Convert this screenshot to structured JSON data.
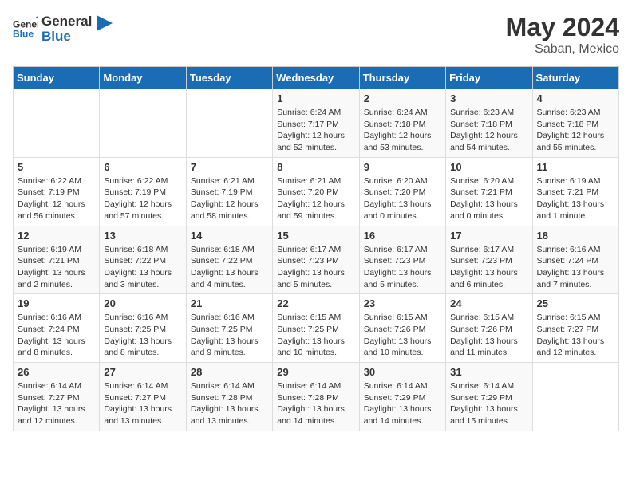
{
  "header": {
    "logo_general": "General",
    "logo_blue": "Blue",
    "month_year": "May 2024",
    "location": "Saban, Mexico"
  },
  "days_of_week": [
    "Sunday",
    "Monday",
    "Tuesday",
    "Wednesday",
    "Thursday",
    "Friday",
    "Saturday"
  ],
  "weeks": [
    [
      {
        "day": "",
        "info": ""
      },
      {
        "day": "",
        "info": ""
      },
      {
        "day": "",
        "info": ""
      },
      {
        "day": "1",
        "info": "Sunrise: 6:24 AM\nSunset: 7:17 PM\nDaylight: 12 hours and 52 minutes."
      },
      {
        "day": "2",
        "info": "Sunrise: 6:24 AM\nSunset: 7:18 PM\nDaylight: 12 hours and 53 minutes."
      },
      {
        "day": "3",
        "info": "Sunrise: 6:23 AM\nSunset: 7:18 PM\nDaylight: 12 hours and 54 minutes."
      },
      {
        "day": "4",
        "info": "Sunrise: 6:23 AM\nSunset: 7:18 PM\nDaylight: 12 hours and 55 minutes."
      }
    ],
    [
      {
        "day": "5",
        "info": "Sunrise: 6:22 AM\nSunset: 7:19 PM\nDaylight: 12 hours and 56 minutes."
      },
      {
        "day": "6",
        "info": "Sunrise: 6:22 AM\nSunset: 7:19 PM\nDaylight: 12 hours and 57 minutes."
      },
      {
        "day": "7",
        "info": "Sunrise: 6:21 AM\nSunset: 7:19 PM\nDaylight: 12 hours and 58 minutes."
      },
      {
        "day": "8",
        "info": "Sunrise: 6:21 AM\nSunset: 7:20 PM\nDaylight: 12 hours and 59 minutes."
      },
      {
        "day": "9",
        "info": "Sunrise: 6:20 AM\nSunset: 7:20 PM\nDaylight: 13 hours and 0 minutes."
      },
      {
        "day": "10",
        "info": "Sunrise: 6:20 AM\nSunset: 7:21 PM\nDaylight: 13 hours and 0 minutes."
      },
      {
        "day": "11",
        "info": "Sunrise: 6:19 AM\nSunset: 7:21 PM\nDaylight: 13 hours and 1 minute."
      }
    ],
    [
      {
        "day": "12",
        "info": "Sunrise: 6:19 AM\nSunset: 7:21 PM\nDaylight: 13 hours and 2 minutes."
      },
      {
        "day": "13",
        "info": "Sunrise: 6:18 AM\nSunset: 7:22 PM\nDaylight: 13 hours and 3 minutes."
      },
      {
        "day": "14",
        "info": "Sunrise: 6:18 AM\nSunset: 7:22 PM\nDaylight: 13 hours and 4 minutes."
      },
      {
        "day": "15",
        "info": "Sunrise: 6:17 AM\nSunset: 7:23 PM\nDaylight: 13 hours and 5 minutes."
      },
      {
        "day": "16",
        "info": "Sunrise: 6:17 AM\nSunset: 7:23 PM\nDaylight: 13 hours and 5 minutes."
      },
      {
        "day": "17",
        "info": "Sunrise: 6:17 AM\nSunset: 7:23 PM\nDaylight: 13 hours and 6 minutes."
      },
      {
        "day": "18",
        "info": "Sunrise: 6:16 AM\nSunset: 7:24 PM\nDaylight: 13 hours and 7 minutes."
      }
    ],
    [
      {
        "day": "19",
        "info": "Sunrise: 6:16 AM\nSunset: 7:24 PM\nDaylight: 13 hours and 8 minutes."
      },
      {
        "day": "20",
        "info": "Sunrise: 6:16 AM\nSunset: 7:25 PM\nDaylight: 13 hours and 8 minutes."
      },
      {
        "day": "21",
        "info": "Sunrise: 6:16 AM\nSunset: 7:25 PM\nDaylight: 13 hours and 9 minutes."
      },
      {
        "day": "22",
        "info": "Sunrise: 6:15 AM\nSunset: 7:25 PM\nDaylight: 13 hours and 10 minutes."
      },
      {
        "day": "23",
        "info": "Sunrise: 6:15 AM\nSunset: 7:26 PM\nDaylight: 13 hours and 10 minutes."
      },
      {
        "day": "24",
        "info": "Sunrise: 6:15 AM\nSunset: 7:26 PM\nDaylight: 13 hours and 11 minutes."
      },
      {
        "day": "25",
        "info": "Sunrise: 6:15 AM\nSunset: 7:27 PM\nDaylight: 13 hours and 12 minutes."
      }
    ],
    [
      {
        "day": "26",
        "info": "Sunrise: 6:14 AM\nSunset: 7:27 PM\nDaylight: 13 hours and 12 minutes."
      },
      {
        "day": "27",
        "info": "Sunrise: 6:14 AM\nSunset: 7:27 PM\nDaylight: 13 hours and 13 minutes."
      },
      {
        "day": "28",
        "info": "Sunrise: 6:14 AM\nSunset: 7:28 PM\nDaylight: 13 hours and 13 minutes."
      },
      {
        "day": "29",
        "info": "Sunrise: 6:14 AM\nSunset: 7:28 PM\nDaylight: 13 hours and 14 minutes."
      },
      {
        "day": "30",
        "info": "Sunrise: 6:14 AM\nSunset: 7:29 PM\nDaylight: 13 hours and 14 minutes."
      },
      {
        "day": "31",
        "info": "Sunrise: 6:14 AM\nSunset: 7:29 PM\nDaylight: 13 hours and 15 minutes."
      },
      {
        "day": "",
        "info": ""
      }
    ]
  ]
}
